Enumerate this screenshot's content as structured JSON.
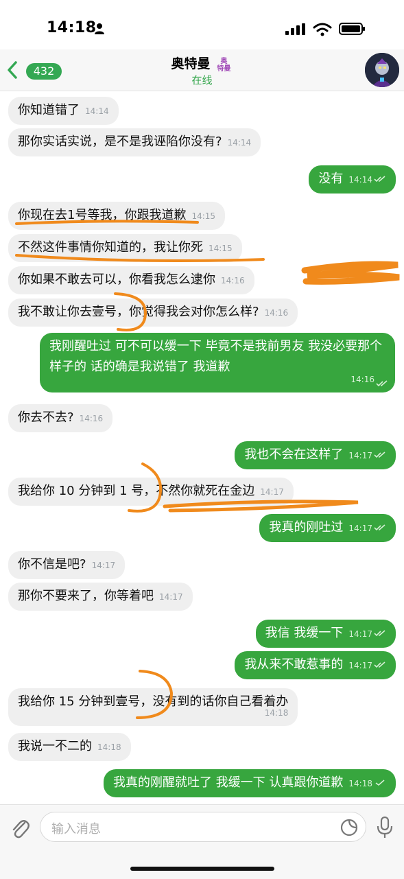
{
  "status_bar": {
    "time": "14:18"
  },
  "header": {
    "back_count": "432",
    "contact_name": "奥特曼",
    "contact_tag_line1": "奥",
    "contact_tag_line2": "特曼",
    "status": "在线"
  },
  "messages": [
    {
      "side": "in",
      "text": "你知道错了",
      "time": "14:14"
    },
    {
      "side": "in",
      "text": "那你实话实说，是不是我诬陷你没有?",
      "time": "14:14"
    },
    {
      "side": "out",
      "text": "没有",
      "time": "14:14"
    },
    {
      "side": "in",
      "text": "你现在去1号等我，你跟我道歉",
      "time": "14:15"
    },
    {
      "side": "in",
      "text": "不然这件事情你知道的，我让你死",
      "time": "14:15"
    },
    {
      "side": "in",
      "text": "你如果不敢去可以，你看我怎么逮你",
      "time": "14:16"
    },
    {
      "side": "in",
      "text": "我不敢让你去壹号，你觉得我会对你怎么样?",
      "time": "14:16"
    },
    {
      "side": "out",
      "text": "我刚醒吐过 可不可以缓一下 毕竟不是我前男友 我没必要那个样子的 话的确是我说错了  我道歉",
      "time": "14:16"
    },
    {
      "side": "in",
      "text": "你去不去?",
      "time": "14:16"
    },
    {
      "side": "out",
      "text": "我也不会在这样了",
      "time": "14:17"
    },
    {
      "side": "in",
      "text": "我给你 10 分钟到 1 号，不然你就死在金边",
      "time": "14:17"
    },
    {
      "side": "out",
      "text": "我真的刚吐过",
      "time": "14:17"
    },
    {
      "side": "in",
      "text": "你不信是吧?",
      "time": "14:17"
    },
    {
      "side": "in",
      "text": "那你不要来了，你等着吧",
      "time": "14:17"
    },
    {
      "side": "out",
      "text": "我信 我缓一下",
      "time": "14:17"
    },
    {
      "side": "out",
      "text": "我从来不敢惹事的",
      "time": "14:17"
    },
    {
      "side": "in",
      "text": "我给你 15 分钟到壹号，没有到的话你自己看着办",
      "time": "14:18"
    },
    {
      "side": "in",
      "text": "我说一不二的",
      "time": "14:18"
    },
    {
      "side": "out",
      "text": "我真的刚醒就吐了 我缓一下 认真跟你道歉",
      "time": "14:18"
    }
  ],
  "input": {
    "placeholder": "输入消息"
  },
  "colors": {
    "outgoing": "#37a63e",
    "incoming": "#efefef",
    "accent": "#34a853",
    "annotation": "#f08a1c"
  },
  "icons": [
    "person-icon",
    "signal-icon",
    "wifi-icon",
    "battery-icon",
    "back-chevron-icon",
    "attach-icon",
    "sticker-icon",
    "mic-icon"
  ]
}
